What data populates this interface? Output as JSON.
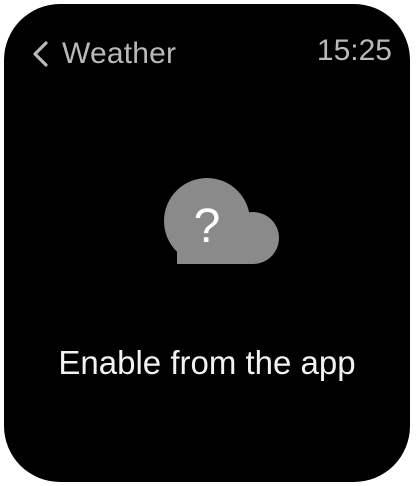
{
  "header": {
    "title": "Weather",
    "time": "15:25",
    "back_icon": "chevron-left-icon"
  },
  "status": {
    "icon": "cloud-question-icon",
    "message": "Enable from the app"
  },
  "colors": {
    "background": "#000000",
    "header_text": "#b9b9b9",
    "icon_fill": "#8a8a8a",
    "message_text": "#f2f2f2"
  }
}
